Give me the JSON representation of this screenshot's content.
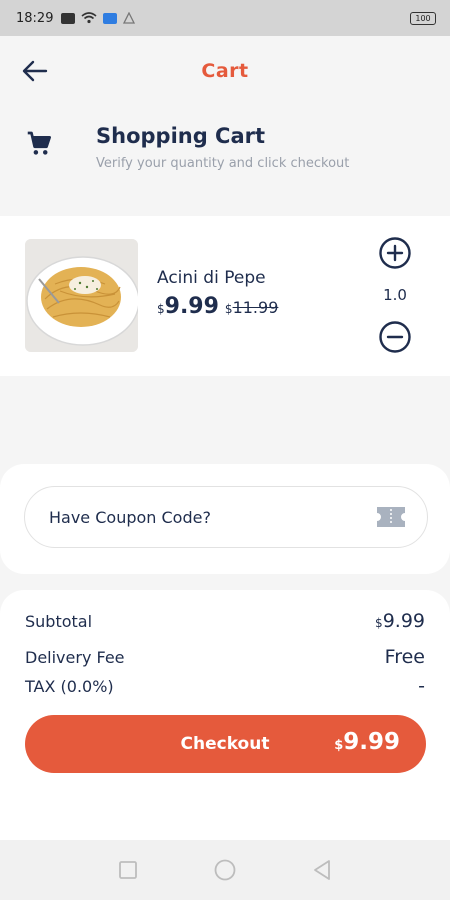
{
  "status_bar": {
    "time": "18:29",
    "battery": "100"
  },
  "app_bar": {
    "title": "Cart"
  },
  "header": {
    "title": "Shopping Cart",
    "subtitle": "Verify your quantity and click checkout"
  },
  "cart_item": {
    "name": "Acini di Pepe",
    "currency": "$",
    "price": "9.99",
    "old_price": "11.99",
    "quantity": "1.0"
  },
  "coupon": {
    "placeholder": "Have Coupon Code?"
  },
  "summary": {
    "subtotal_label": "Subtotal",
    "subtotal_currency": "$",
    "subtotal_value": "9.99",
    "delivery_label": "Delivery Fee",
    "delivery_value": "Free",
    "tax_label": "TAX (0.0%)",
    "tax_value": "-"
  },
  "checkout": {
    "label": "Checkout",
    "currency": "$",
    "total": "9.99"
  },
  "colors": {
    "accent": "#e55a3c",
    "text": "#1f2d4d",
    "muted": "#9aa0ab"
  }
}
